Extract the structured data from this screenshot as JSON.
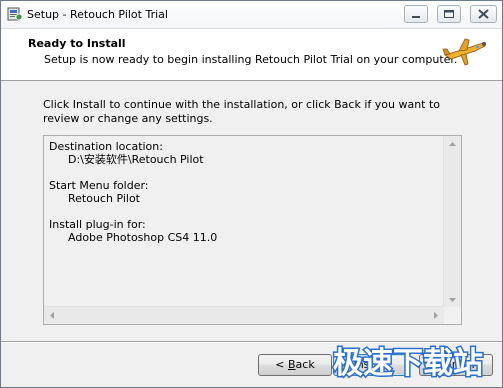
{
  "window": {
    "title": "Setup - Retouch Pilot Trial",
    "controls": [
      "minimize-icon",
      "maximize-icon",
      "close-icon"
    ]
  },
  "header": {
    "title": "Ready to Install",
    "subtitle": "Setup is now ready to begin installing Retouch Pilot Trial on your computer."
  },
  "body": {
    "intro": "Click Install to continue with the installation, or click Back if you want to review or change any settings.",
    "memo": {
      "destination_label": "Destination location:",
      "destination_value": "D:\\安装软件\\Retouch Pilot",
      "start_menu_label": "Start Menu folder:",
      "start_menu_value": "Retouch Pilot",
      "plugin_label": "Install plug-in for:",
      "plugin_value": "Adobe Photoshop CS4 11.0"
    }
  },
  "footer": {
    "back_prefix": "< ",
    "back_accel": "B",
    "back_rest": "ack",
    "install_accel": "I",
    "install_rest": "nstall",
    "cancel_label": "Cancel"
  },
  "watermark": {
    "text": "极速下载站"
  },
  "colors": {
    "watermark": "#2a6fd1",
    "plane": "#f0b030"
  }
}
